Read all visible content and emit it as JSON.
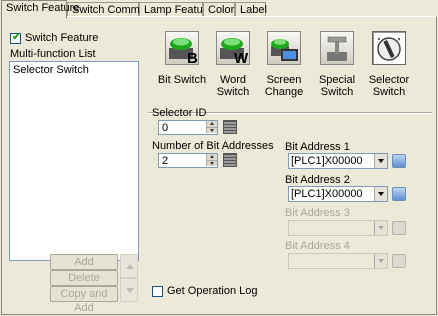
{
  "tabs": [
    {
      "label": "Switch Feature",
      "active": true
    },
    {
      "label": "Switch Common",
      "active": false
    },
    {
      "label": "Lamp Feature",
      "active": false
    },
    {
      "label": "Color",
      "active": false
    },
    {
      "label": "Label",
      "active": false
    }
  ],
  "switch_feature": {
    "label": "Switch Feature",
    "checked": true
  },
  "multifunction": {
    "title": "Multi-function List",
    "items": [
      "Selector Switch"
    ],
    "add_label": "Add",
    "delete_label": "Delete",
    "copy_add_label": "Copy and Add"
  },
  "switch_types": [
    {
      "label1": "Bit Switch",
      "label2": "",
      "icon": "bit-switch-icon"
    },
    {
      "label1": "Word",
      "label2": "Switch",
      "icon": "word-switch-icon"
    },
    {
      "label1": "Screen",
      "label2": "Change",
      "icon": "screen-change-icon"
    },
    {
      "label1": "Special",
      "label2": "Switch",
      "icon": "special-switch-icon"
    },
    {
      "label1": "Selector",
      "label2": "Switch",
      "icon": "selector-switch-icon",
      "selected": true
    }
  ],
  "selector_id": {
    "label": "Selector ID",
    "value": "0"
  },
  "num_bit_addresses": {
    "label": "Number of Bit Addresses",
    "value": "2"
  },
  "bit_addresses": [
    {
      "label": "Bit Address 1",
      "value": "[PLC1]X00000",
      "enabled": true
    },
    {
      "label": "Bit Address 2",
      "value": "[PLC1]X00000",
      "enabled": true
    },
    {
      "label": "Bit Address 3",
      "value": "",
      "enabled": false
    },
    {
      "label": "Bit Address 4",
      "value": "",
      "enabled": false
    }
  ],
  "operation_log": {
    "label": "Get Operation Log",
    "checked": false
  }
}
